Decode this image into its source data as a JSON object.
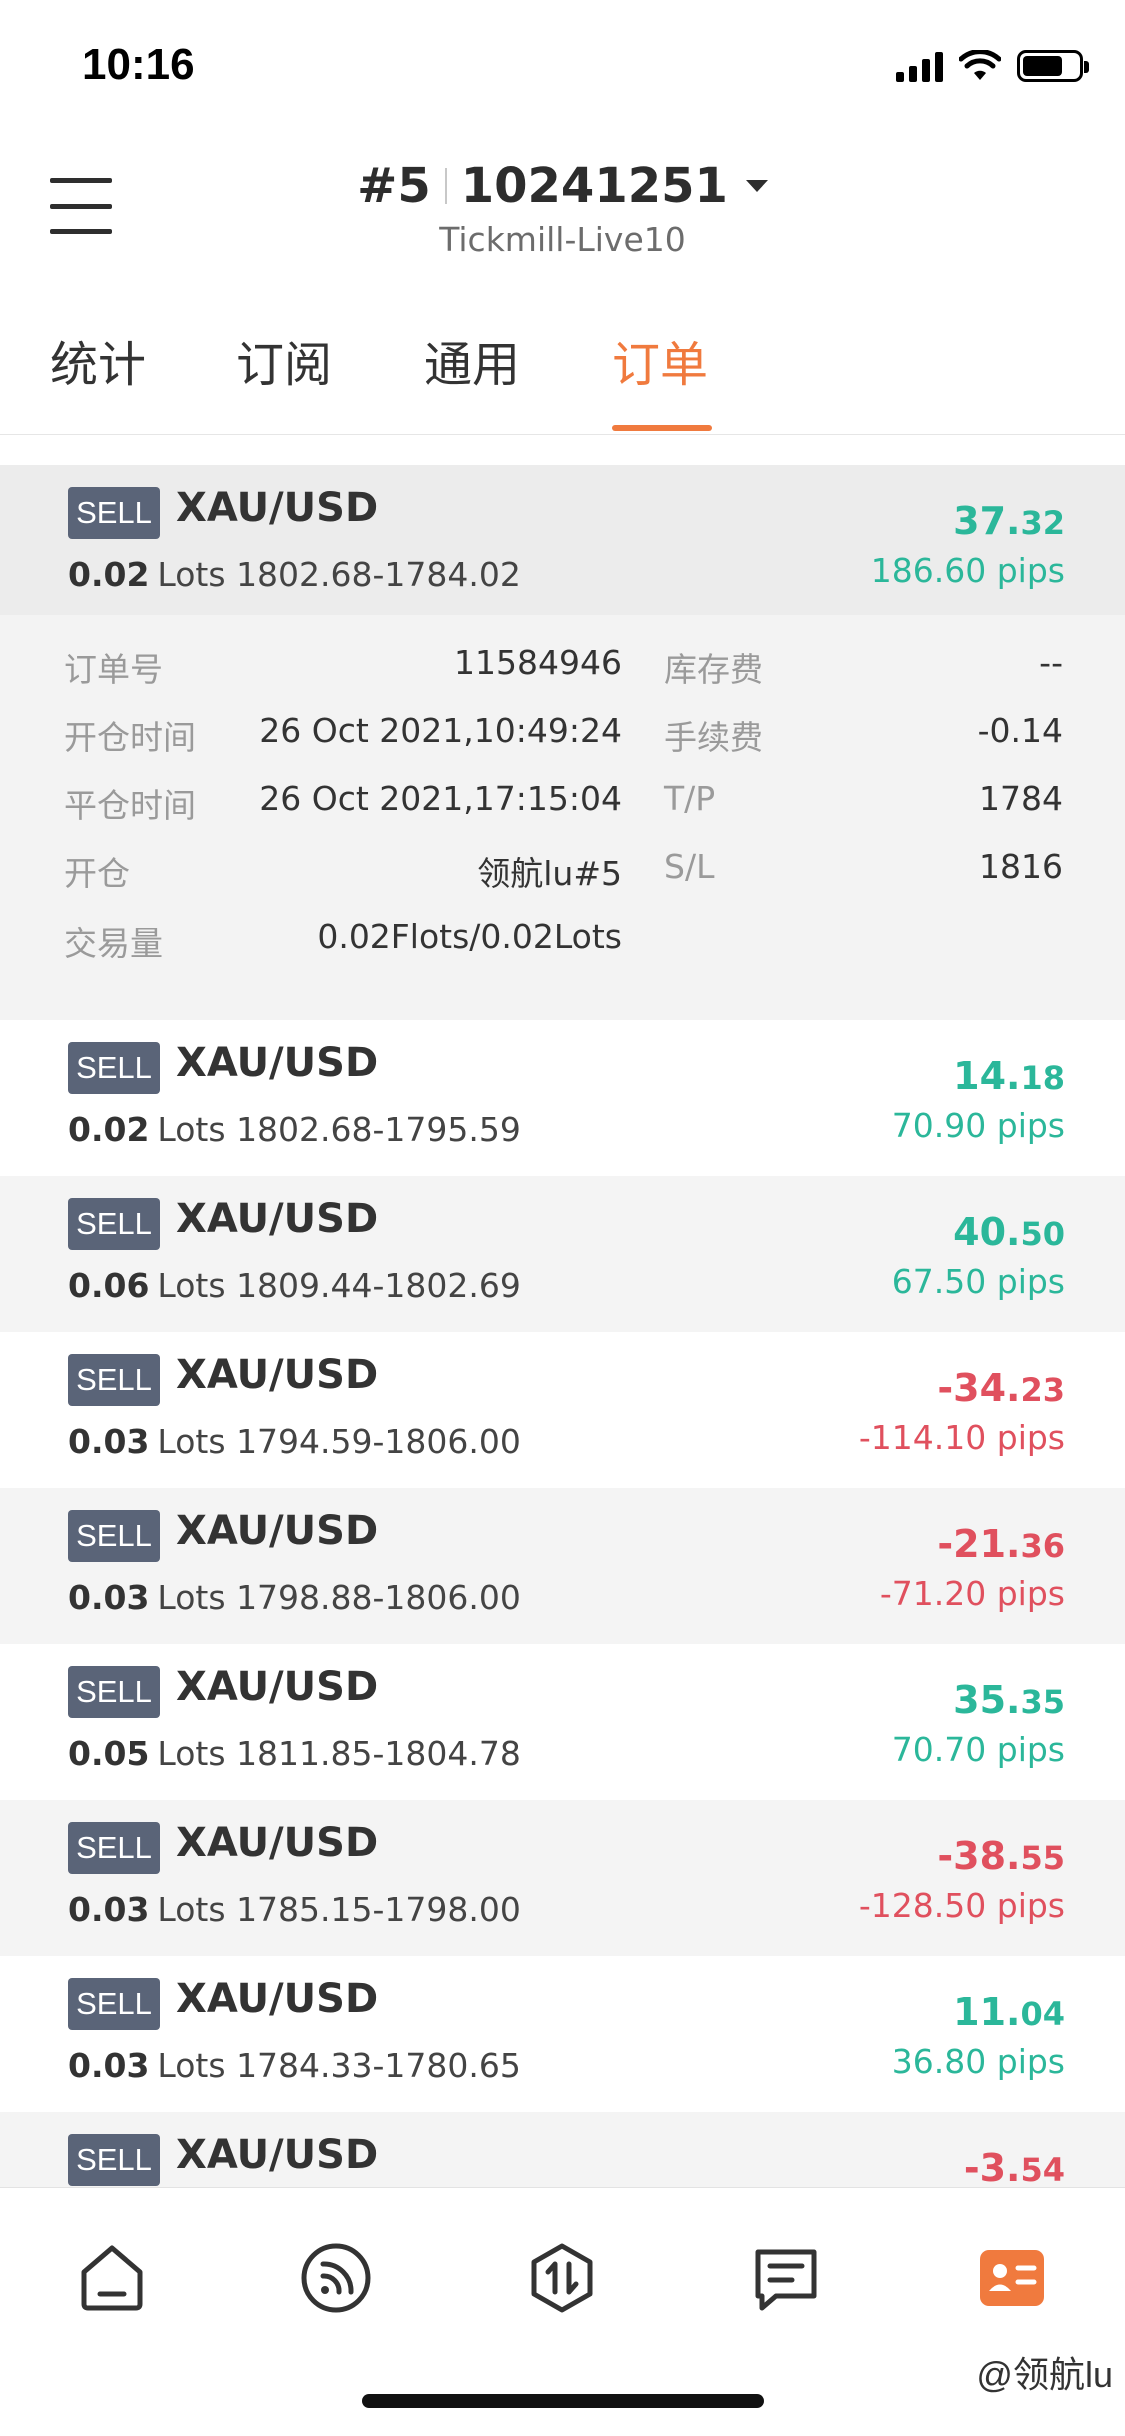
{
  "status_bar": {
    "time": "10:16"
  },
  "header": {
    "account_prefix": "#5",
    "account_number": "10241251",
    "server": "Tickmill-Live10"
  },
  "tabs": [
    {
      "label": "统计",
      "active": false
    },
    {
      "label": "订阅",
      "active": false
    },
    {
      "label": "通用",
      "active": false
    },
    {
      "label": "订单",
      "active": true
    }
  ],
  "selected_order": {
    "badge": "SELL",
    "pair": "XAU/USD",
    "lots": "0.02",
    "lots_label": "Lots",
    "prices": "1802.68-1784.02",
    "profit_main": "37.",
    "profit_cents": "32",
    "pips": "186.60 pips",
    "direction": "green",
    "details": {
      "order_no_label": "订单号",
      "order_no": "11584946",
      "open_time_label": "开仓时间",
      "open_time": "26 Oct 2021,10:49:24",
      "close_time_label": "平仓时间",
      "close_time": "26 Oct 2021,17:15:04",
      "open_label": "开仓",
      "open_value": "领航lu#5",
      "volume_label": "交易量",
      "volume": "0.02Flots/0.02Lots",
      "swap_label": "库存费",
      "swap": "--",
      "commission_label": "手续费",
      "commission": "-0.14",
      "tp_label": "T/P",
      "tp": "1784",
      "sl_label": "S/L",
      "sl": "1816"
    }
  },
  "orders": [
    {
      "badge": "SELL",
      "pair": "XAU/USD",
      "lots": "0.02",
      "lots_label": "Lots",
      "prices": "1802.68-1795.59",
      "profit_main": "14.",
      "profit_cents": "18",
      "pips": "70.90 pips",
      "direction": "green"
    },
    {
      "badge": "SELL",
      "pair": "XAU/USD",
      "lots": "0.06",
      "lots_label": "Lots",
      "prices": "1809.44-1802.69",
      "profit_main": "40.",
      "profit_cents": "50",
      "pips": "67.50 pips",
      "direction": "green"
    },
    {
      "badge": "SELL",
      "pair": "XAU/USD",
      "lots": "0.03",
      "lots_label": "Lots",
      "prices": "1794.59-1806.00",
      "profit_main": "-34.",
      "profit_cents": "23",
      "pips": "-114.10 pips",
      "direction": "red"
    },
    {
      "badge": "SELL",
      "pair": "XAU/USD",
      "lots": "0.03",
      "lots_label": "Lots",
      "prices": "1798.88-1806.00",
      "profit_main": "-21.",
      "profit_cents": "36",
      "pips": "-71.20 pips",
      "direction": "red"
    },
    {
      "badge": "SELL",
      "pair": "XAU/USD",
      "lots": "0.05",
      "lots_label": "Lots",
      "prices": "1811.85-1804.78",
      "profit_main": "35.",
      "profit_cents": "35",
      "pips": "70.70 pips",
      "direction": "green"
    },
    {
      "badge": "SELL",
      "pair": "XAU/USD",
      "lots": "0.03",
      "lots_label": "Lots",
      "prices": "1785.15-1798.00",
      "profit_main": "-38.",
      "profit_cents": "55",
      "pips": "-128.50 pips",
      "direction": "red"
    },
    {
      "badge": "SELL",
      "pair": "XAU/USD",
      "lots": "0.03",
      "lots_label": "Lots",
      "prices": "1784.33-1780.65",
      "profit_main": "11.",
      "profit_cents": "04",
      "pips": "36.80 pips",
      "direction": "green"
    },
    {
      "badge": "SELL",
      "pair": "XAU/USD",
      "lots": "",
      "lots_label": "",
      "prices": "",
      "profit_main": "-3.",
      "profit_cents": "54",
      "pips": "",
      "direction": "red"
    }
  ],
  "bottom_nav": [
    {
      "icon": "home-icon"
    },
    {
      "icon": "signal-feed-icon"
    },
    {
      "icon": "trade-icon"
    },
    {
      "icon": "message-icon"
    },
    {
      "icon": "profile-card-icon",
      "active": true
    }
  ],
  "watermark": "@领航lu",
  "colors": {
    "accent": "#f07a3e",
    "profit": "#2bb79a",
    "loss": "#e0505e",
    "badge": "#5a6478"
  }
}
